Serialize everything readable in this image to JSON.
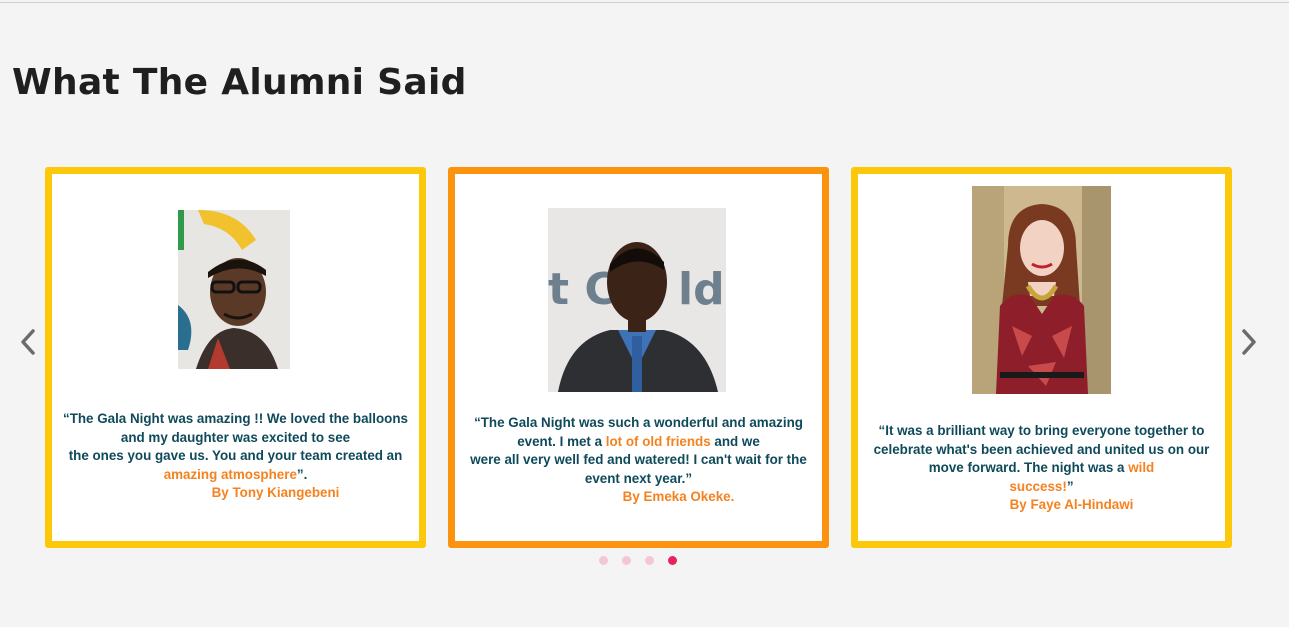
{
  "page": {
    "heading": "What The Alumni Said"
  },
  "carousel": {
    "prev_icon": "chevron-left-icon",
    "next_icon": "chevron-right-icon",
    "dots_count": 4,
    "active_dot": 4,
    "testimonials": [
      {
        "q1": "“The Gala Night was amazing !! We loved the balloons",
        "q2": "and my daughter was excited to see",
        "q3": "the ones you gave us. You and your team created an",
        "q4_highlight": "amazing atmosphere",
        "q4_rest": "”.",
        "author": "By Tony Kiangebeni"
      },
      {
        "q1": "“The Gala Night was such a wonderful and amazing",
        "q2_pre": "event. I met a ",
        "q2_highlight": "lot of old friends",
        "q2_post": " and we",
        "q3": "were all very well fed and watered! I can't wait for the",
        "q4": "event next year.”",
        "author": "By  Emeka Okeke."
      },
      {
        "q1": "“It was a brilliant way to bring everyone together to",
        "q2": "celebrate what's been achieved and united us on our",
        "q3_pre": "move forward. The night was a ",
        "q3_highlight": "wild",
        "q4_highlight": "success!",
        "q4_rest": "”",
        "author": "By Faye Al-Hindawi"
      }
    ]
  },
  "colors": {
    "card_border": "#fdc80a",
    "active_card_border": "#fb930f",
    "quote_text": "#0f4a5a",
    "highlight": "#f58220",
    "dot_inactive": "#f5c6d3",
    "dot_active": "#e8245a"
  }
}
